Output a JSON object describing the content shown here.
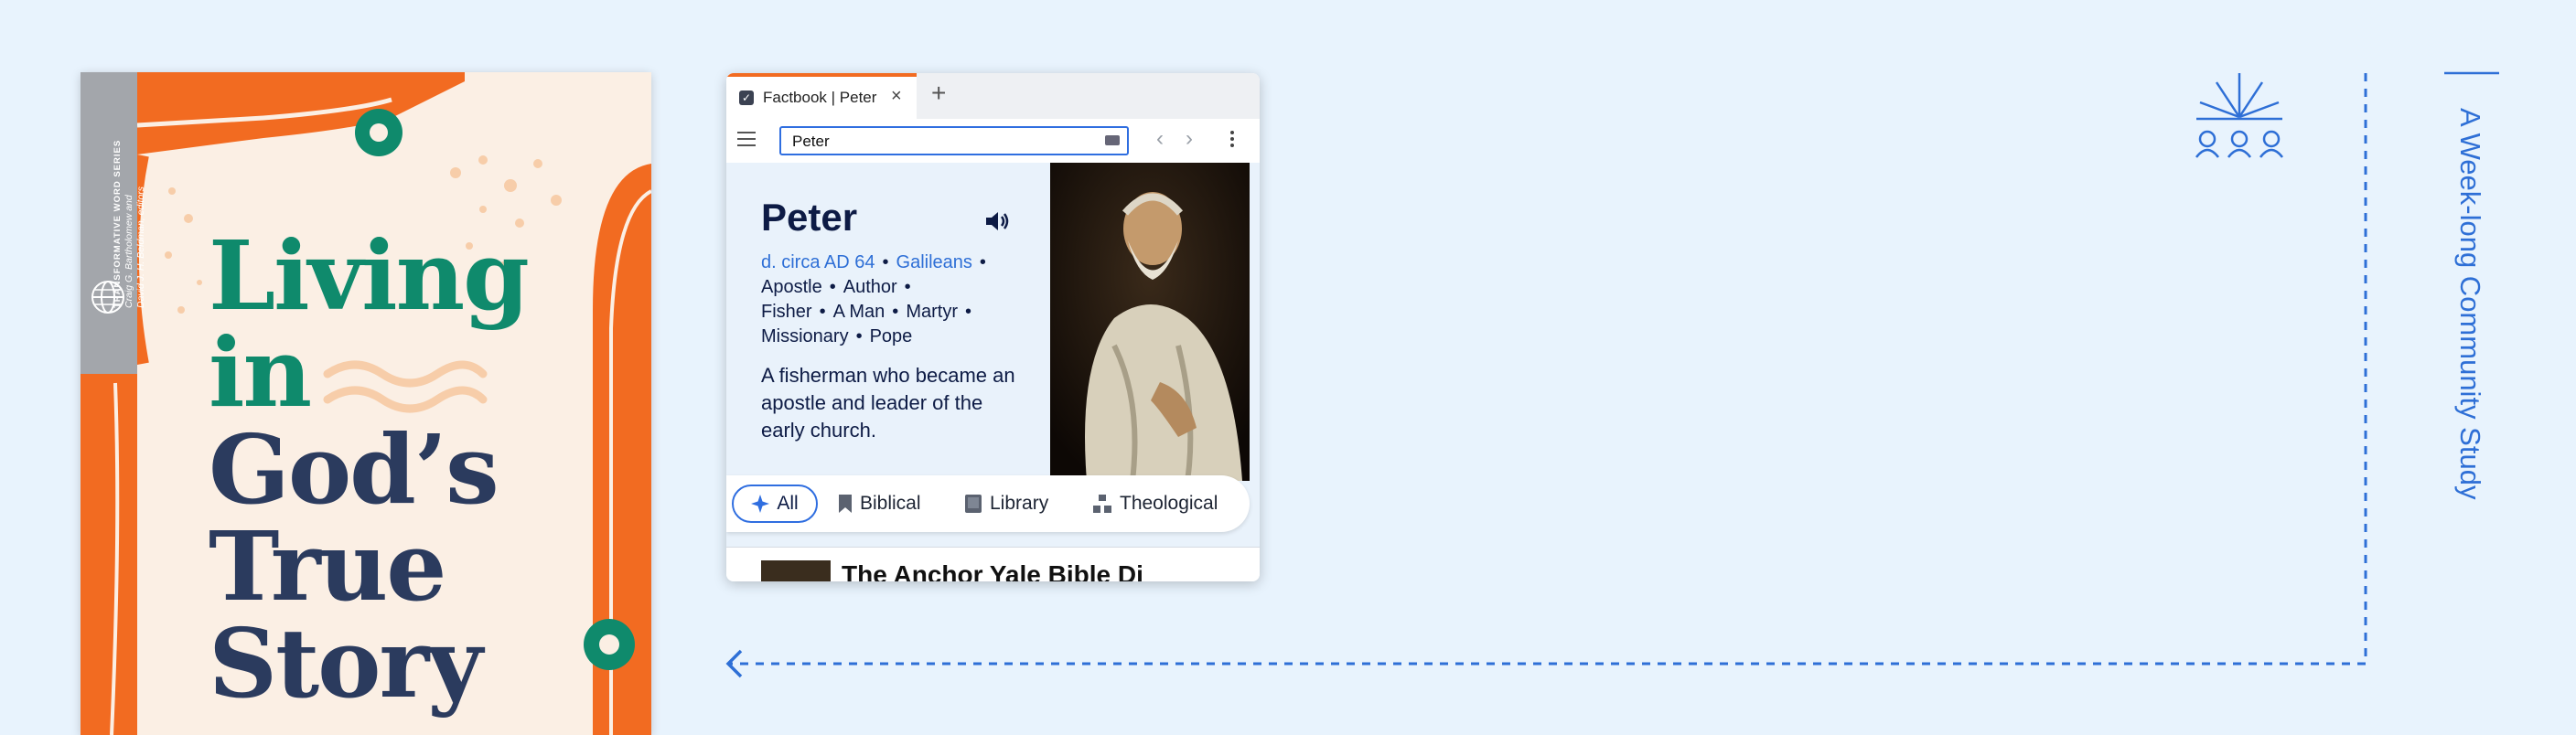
{
  "cover": {
    "series": "TRANSFORMATIVE WORD SERIES",
    "editors_line1": "Craig G. Bartholomew and",
    "editors_line2": "David J. H. Beldman, editors",
    "title_lines": [
      "Living",
      "in",
      "God’s",
      "True",
      "Story"
    ],
    "colors": {
      "green": "#0f8a6c",
      "navy": "#2b3b5e",
      "orange": "#f26b21"
    }
  },
  "browser": {
    "tab_title": "Factbook | Peter",
    "tab_close": "×",
    "new_tab": "+",
    "search_value": "Peter",
    "nav_back": "‹",
    "nav_forward": "›"
  },
  "entry": {
    "title": "Peter",
    "meta": {
      "date": "d. circa AD 64",
      "link": "Galileans",
      "roles": [
        "Apostle",
        "Author",
        "Fisher",
        "A Man",
        "Martyr",
        "Missionary",
        "Pope"
      ]
    },
    "description": "A fisherman who became an apostle and leader of the early church."
  },
  "filters": [
    {
      "label": "All",
      "icon": "sparkle-icon"
    },
    {
      "label": "Biblical",
      "icon": "bookmark-icon"
    },
    {
      "label": "Library",
      "icon": "book-icon"
    },
    {
      "label": "Theological",
      "icon": "hierarchy-icon"
    }
  ],
  "result": {
    "title": "The Anchor Yale Bible Di"
  },
  "side": {
    "caption": "A Week-long Community Study"
  },
  "colors": {
    "accent": "#2f6ee0",
    "background": "#e8f3fd"
  }
}
